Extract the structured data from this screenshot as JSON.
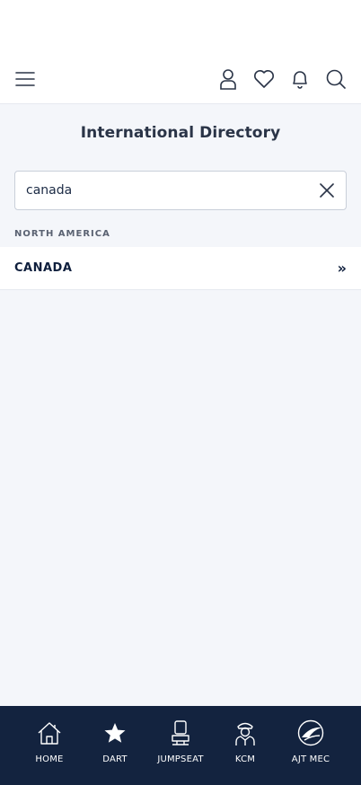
{
  "header": {
    "icons": [
      "menu-icon",
      "profile-icon",
      "heart-icon",
      "bell-icon",
      "search-icon"
    ]
  },
  "page": {
    "title": "International Directory"
  },
  "search": {
    "value": "canada",
    "placeholder": ""
  },
  "results": {
    "section_label": "NORTH AMERICA",
    "items": [
      {
        "label": "CANADA",
        "chevron": "»"
      }
    ]
  },
  "tab_bar": {
    "items": [
      {
        "label": "HOME",
        "icon": "home-icon"
      },
      {
        "label": "DART",
        "icon": "star-icon"
      },
      {
        "label": "JUMPSEAT",
        "icon": "seat-icon"
      },
      {
        "label": "KCM",
        "icon": "pilot-icon"
      },
      {
        "label": "AJT MEC",
        "icon": "ajt-logo-icon"
      }
    ]
  },
  "colors": {
    "background": "#f4f6fa",
    "tab_bar": "#13233f",
    "text_dark": "#0f1f3d"
  }
}
